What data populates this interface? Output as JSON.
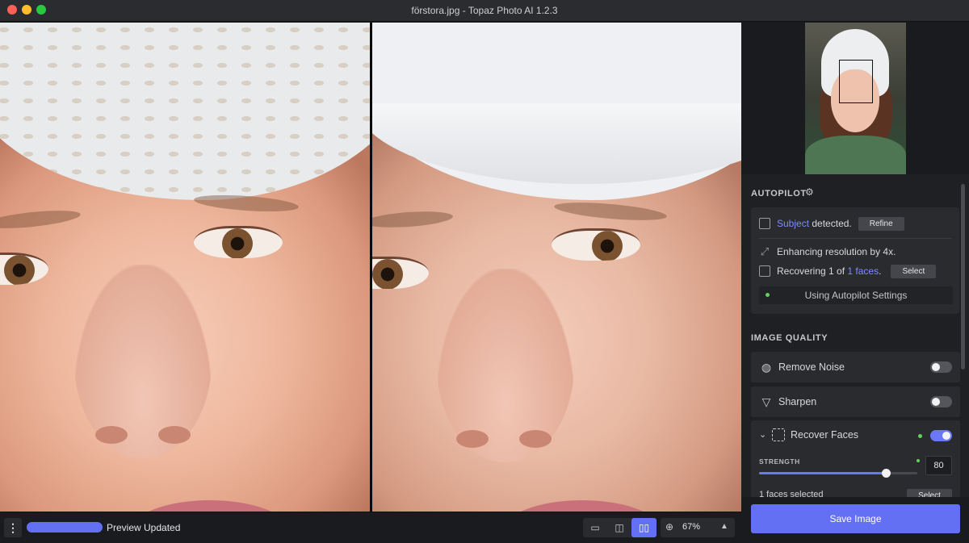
{
  "window": {
    "title": "förstora.jpg - Topaz Photo AI 1.2.3"
  },
  "autopilot": {
    "title": "AUTOPILOT",
    "subject_link": "Subject",
    "subject_text": "detected.",
    "refine_label": "Refine",
    "enhance_text": "Enhancing resolution by 4x.",
    "recover_prefix": "Recovering 1 of",
    "faces_link": "1 faces",
    "recover_suffix": ".",
    "select_label": "Select",
    "settings_label": "Using Autopilot Settings"
  },
  "image_quality": {
    "title": "IMAGE QUALITY",
    "remove_noise": {
      "label": "Remove Noise",
      "enabled": false,
      "icon": "noise-icon"
    },
    "sharpen": {
      "label": "Sharpen",
      "enabled": false,
      "icon": "sharpen-icon"
    },
    "recover_faces": {
      "label": "Recover Faces",
      "enabled": true,
      "strength_label": "STRENGTH",
      "strength_value": "80",
      "strength_fraction": 0.8,
      "faces_selected": "1 faces selected",
      "select_label": "Select"
    }
  },
  "save_button": "Save Image",
  "bottom": {
    "menu_icon": "⋮",
    "progress_fraction": 1.0,
    "status": "Preview Updated",
    "zoom": "67%"
  },
  "colors": {
    "accent": "#6470f4",
    "link": "#7d8cff",
    "active_dot": "#5fd35a"
  }
}
